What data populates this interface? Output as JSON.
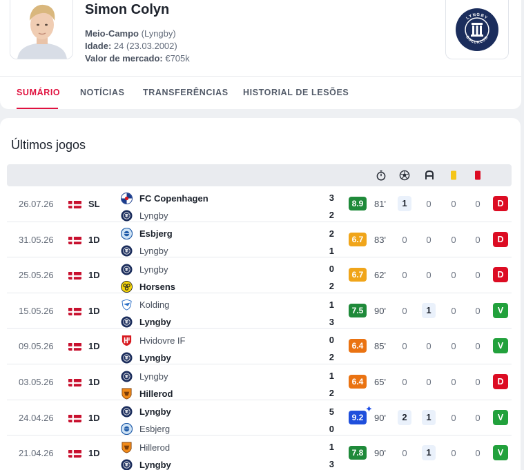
{
  "player": {
    "name": "Simon Colyn",
    "position_label": "Meio-Campo",
    "club_paren": "(Lyngby)",
    "age_label": "Idade:",
    "age_value": "24 (23.03.2002)",
    "value_label": "Valor de mercado:",
    "value_value": "€705k"
  },
  "club_logo": {
    "text_top": "LYNGBY",
    "text_bottom": "BOLDKLUB",
    "color": "#1b2d5c"
  },
  "tabs": [
    {
      "label": "SUMÁRIO",
      "active": true
    },
    {
      "label": "NOTÍCIAS",
      "active": false
    },
    {
      "label": "TRANSFERÊNCIAS",
      "active": false
    },
    {
      "label": "HISTORIAL DE LESÕES",
      "active": false
    }
  ],
  "section_title": "Últimos jogos",
  "header_icons": [
    "stopwatch-icon",
    "football-icon",
    "assist-icon",
    "yellow-card-icon",
    "red-card-icon"
  ],
  "colors": {
    "accent": "#e0123f",
    "win": "#22a13c",
    "loss": "#dc0c23",
    "rating_green": "#1f8a3a",
    "rating_orange": "#f0a51a",
    "rating_deep_orange": "#ea7312",
    "rating_blue": "#1f4fdc"
  },
  "matches": [
    {
      "date": "26.07.26",
      "competition": "SL",
      "home": "FC Copenhagen",
      "home_logo": "copenhagen",
      "away": "Lyngby",
      "away_logo": "lyngby",
      "winner": "home",
      "home_score": "3",
      "away_score": "2",
      "rating": "8.9",
      "rating_color": "#1f8a3a",
      "star": false,
      "minutes": "81'",
      "goals": "1",
      "assists": "0",
      "yellow": "0",
      "red": "0",
      "result": "D"
    },
    {
      "date": "31.05.26",
      "competition": "1D",
      "home": "Esbjerg",
      "home_logo": "esbjerg",
      "away": "Lyngby",
      "away_logo": "lyngby",
      "winner": "home",
      "home_score": "2",
      "away_score": "1",
      "rating": "6.7",
      "rating_color": "#f0a51a",
      "star": false,
      "minutes": "83'",
      "goals": "0",
      "assists": "0",
      "yellow": "0",
      "red": "0",
      "result": "D"
    },
    {
      "date": "25.05.26",
      "competition": "1D",
      "home": "Lyngby",
      "home_logo": "lyngby",
      "away": "Horsens",
      "away_logo": "horsens",
      "winner": "away",
      "home_score": "0",
      "away_score": "2",
      "rating": "6.7",
      "rating_color": "#f0a51a",
      "star": false,
      "minutes": "62'",
      "goals": "0",
      "assists": "0",
      "yellow": "0",
      "red": "0",
      "result": "D"
    },
    {
      "date": "15.05.26",
      "competition": "1D",
      "home": "Kolding",
      "home_logo": "kolding",
      "away": "Lyngby",
      "away_logo": "lyngby",
      "winner": "away",
      "home_score": "1",
      "away_score": "3",
      "rating": "7.5",
      "rating_color": "#1f8a3a",
      "star": false,
      "minutes": "90'",
      "goals": "0",
      "assists": "1",
      "yellow": "0",
      "red": "0",
      "result": "V"
    },
    {
      "date": "09.05.26",
      "competition": "1D",
      "home": "Hvidovre IF",
      "home_logo": "hvidovre",
      "away": "Lyngby",
      "away_logo": "lyngby",
      "winner": "away",
      "home_score": "0",
      "away_score": "2",
      "rating": "6.4",
      "rating_color": "#ea7312",
      "star": false,
      "minutes": "85'",
      "goals": "0",
      "assists": "0",
      "yellow": "0",
      "red": "0",
      "result": "V"
    },
    {
      "date": "03.05.26",
      "competition": "1D",
      "home": "Lyngby",
      "home_logo": "lyngby",
      "away": "Hillerod",
      "away_logo": "hillerod",
      "winner": "away",
      "home_score": "1",
      "away_score": "2",
      "rating": "6.4",
      "rating_color": "#ea7312",
      "star": false,
      "minutes": "65'",
      "goals": "0",
      "assists": "0",
      "yellow": "0",
      "red": "0",
      "result": "D"
    },
    {
      "date": "24.04.26",
      "competition": "1D",
      "home": "Lyngby",
      "home_logo": "lyngby",
      "away": "Esbjerg",
      "away_logo": "esbjerg",
      "winner": "home",
      "home_score": "5",
      "away_score": "0",
      "rating": "9.2",
      "rating_color": "#1f4fdc",
      "star": true,
      "minutes": "90'",
      "goals": "2",
      "assists": "1",
      "yellow": "0",
      "red": "0",
      "result": "V"
    },
    {
      "date": "21.04.26",
      "competition": "1D",
      "home": "Hillerod",
      "home_logo": "hillerod",
      "away": "Lyngby",
      "away_logo": "lyngby",
      "winner": "away",
      "home_score": "1",
      "away_score": "3",
      "rating": "7.8",
      "rating_color": "#1f8a3a",
      "star": false,
      "minutes": "90'",
      "goals": "0",
      "assists": "1",
      "yellow": "0",
      "red": "0",
      "result": "V"
    }
  ]
}
